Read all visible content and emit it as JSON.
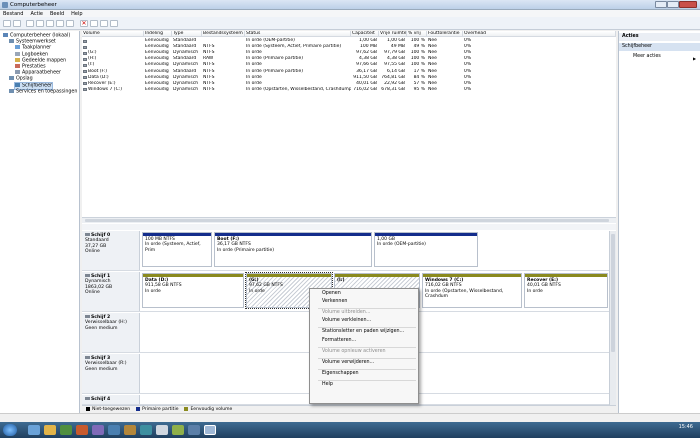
{
  "window": {
    "title": "Computerbeheer",
    "menu": [
      "Bestand",
      "Actie",
      "Beeld",
      "Help"
    ]
  },
  "tree": {
    "items": [
      {
        "label": "Computerbeheer (lokaal)",
        "level": 0
      },
      {
        "label": "Systeemwerkset",
        "level": 1
      },
      {
        "label": "Taakplanner",
        "level": 2
      },
      {
        "label": "Logboeken",
        "level": 2
      },
      {
        "label": "Gedeelde mappen",
        "level": 2
      },
      {
        "label": "Prestaties",
        "level": 2
      },
      {
        "label": "Apparaatbeheer",
        "level": 2
      },
      {
        "label": "Opslag",
        "level": 1
      },
      {
        "label": "Schijfbeheer",
        "level": 2
      },
      {
        "label": "Services en toepassingen",
        "level": 1
      }
    ]
  },
  "volumes": {
    "columns": [
      "Volume",
      "Indeling",
      "Type",
      "Bestandssysteem",
      "Status",
      "Capaciteit",
      "Vrije ruimte",
      "% vrij",
      "Fouttolerantie",
      "Overhead"
    ],
    "rows": [
      [
        "",
        "Eenvoudig",
        "Standaard",
        "",
        "In orde (OEM-partitie)",
        "1,00 GB",
        "1,00 GB",
        "100 %",
        "Nee",
        "0%"
      ],
      [
        "",
        "Eenvoudig",
        "Standaard",
        "NTFS",
        "In orde (Systeem, Actief, Primaire partitie)",
        "100 MB",
        "49 MB",
        "49 %",
        "Nee",
        "0%"
      ],
      [
        "(G:)",
        "Eenvoudig",
        "Dynamisch",
        "NTFS",
        "In orde",
        "97,62 GB",
        "97,79 GB",
        "100 %",
        "Nee",
        "0%"
      ],
      [
        "(H:)",
        "Eenvoudig",
        "Standaard",
        "RAW",
        "In orde (Primaire partitie)",
        "4,38 GB",
        "4,38 GB",
        "100 %",
        "Nee",
        "0%"
      ],
      [
        "(I:)",
        "Eenvoudig",
        "Dynamisch",
        "NTFS",
        "In orde",
        "97,66 GB",
        "97,55 GB",
        "100 %",
        "Nee",
        "0%"
      ],
      [
        "Boot (F:)",
        "Eenvoudig",
        "Standaard",
        "NTFS",
        "In orde (Primaire partitie)",
        "36,17 GB",
        "6,14 GB",
        "17 %",
        "Nee",
        "0%"
      ],
      [
        "Data (D:)",
        "Eenvoudig",
        "Dynamisch",
        "NTFS",
        "In orde",
        "911,50 GB",
        "764,81 GB",
        "84 %",
        "Nee",
        "0%"
      ],
      [
        "Recover (E:)",
        "Eenvoudig",
        "Dynamisch",
        "NTFS",
        "In orde",
        "40,01 GB",
        "22,92 GB",
        "57 %",
        "Nee",
        "0%"
      ],
      [
        "Windows 7 (C:)",
        "Eenvoudig",
        "Dynamisch",
        "NTFS",
        "In orde (Opstarten, Wisselbestand, Crashdump)",
        "716,02 GB",
        "678,31 GB",
        "95 %",
        "Nee",
        "0%"
      ]
    ]
  },
  "disks": [
    {
      "name": "Schijf 0",
      "type": "Standaard",
      "size": "37,27 GB",
      "state": "Online",
      "parts": [
        {
          "name": "",
          "size": "100 MB NTFS",
          "status": "In orde (Systeem, Actief, Prim",
          "color": "blue"
        },
        {
          "name": "Boot (F:)",
          "size": "36,17 GB NTFS",
          "status": "In orde (Primaire partitie)",
          "color": "blue"
        },
        {
          "name": "",
          "size": "1,00 GB",
          "status": "In orde (OEM-partitie)",
          "color": "blue"
        }
      ]
    },
    {
      "name": "Schijf 1",
      "type": "Dynamisch",
      "size": "1863,02 GB",
      "state": "Online",
      "parts": [
        {
          "name": "Data (D:)",
          "size": "911,58 GB NTFS",
          "status": "In orde",
          "color": "olive"
        },
        {
          "name": "(G:)",
          "size": "97,62 GB NTFS",
          "status": "In orde",
          "color": "olive"
        },
        {
          "name": "(I:)",
          "size": "",
          "status": "",
          "color": "olive"
        },
        {
          "name": "Windows 7 (C:)",
          "size": "716,02 GB NTFS",
          "status": "In orde (Opstarten, Wisselbestand, Crashdum",
          "color": "olive"
        },
        {
          "name": "Recover (E:)",
          "size": "40,01 GB NTFS",
          "status": "In orde",
          "color": "olive"
        }
      ]
    },
    {
      "name": "Schijf 2",
      "type": "Verwisselbaar (H:)",
      "size": "",
      "state": "Geen medium",
      "parts": []
    },
    {
      "name": "Schijf 3",
      "type": "Verwisselbaar (R:)",
      "size": "",
      "state": "Geen medium",
      "parts": []
    },
    {
      "name": "Schijf 4",
      "type": "",
      "size": "",
      "state": "",
      "parts": []
    }
  ],
  "legend": [
    {
      "label": "Niet-toegewezen",
      "color": "#000000"
    },
    {
      "label": "Primaire partitie",
      "color": "#142d8c"
    },
    {
      "label": "Eenvoudig volume",
      "color": "#8a8a1e"
    }
  ],
  "actions": {
    "header": "Acties",
    "section": "Schijfbeheer",
    "more": "Meer acties"
  },
  "context_menu": [
    {
      "label": "Openen",
      "disabled": false
    },
    {
      "label": "Verkennen",
      "disabled": false
    },
    {
      "sep": true
    },
    {
      "label": "Volume uitbreiden...",
      "disabled": true
    },
    {
      "label": "Volume verkleinen...",
      "disabled": false
    },
    {
      "sep": true
    },
    {
      "label": "Stationsletter en paden wijzigen...",
      "disabled": false
    },
    {
      "label": "Formatteren...",
      "disabled": false
    },
    {
      "sep": true
    },
    {
      "label": "Volume opnieuw activeren",
      "disabled": true
    },
    {
      "sep": true
    },
    {
      "label": "Volume verwijderen...",
      "disabled": false
    },
    {
      "sep": true
    },
    {
      "label": "Eigenschappen",
      "disabled": false
    },
    {
      "sep": true
    },
    {
      "label": "Help",
      "disabled": false
    }
  ],
  "clock": {
    "time": "15:46"
  }
}
